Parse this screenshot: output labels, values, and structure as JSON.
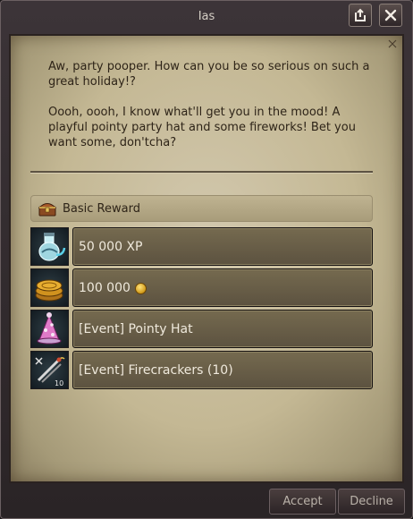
{
  "window": {
    "title": "Ias"
  },
  "dialog": {
    "paragraphs": [
      "Aw, party pooper. How can you be so serious on such a great holiday!?",
      "Oooh, oooh, I know what'll get you in the mood! A playful pointy party hat and some fireworks! Bet you want some, don'tcha?"
    ]
  },
  "rewards": {
    "header_label": "Basic Reward",
    "header_icon": "treasure-chest-icon",
    "items": [
      {
        "label": "50 000 XP",
        "icon": "xp-potion-icon"
      },
      {
        "label": "100 000",
        "icon": "gold-coins-icon",
        "currency_icon": "gold-coin-icon"
      },
      {
        "label": "[Event] Pointy Hat",
        "icon": "party-hat-icon"
      },
      {
        "label": "[Event] Firecrackers (10)",
        "icon": "firecrackers-icon"
      }
    ]
  },
  "buttons": {
    "accept": "Accept",
    "decline": "Decline"
  },
  "colors": {
    "parchment": "#c4b894",
    "item_box": "#6a5f48",
    "frame": "#2a2426",
    "text_dark": "#2e2418",
    "text_light": "#efe9dc"
  }
}
